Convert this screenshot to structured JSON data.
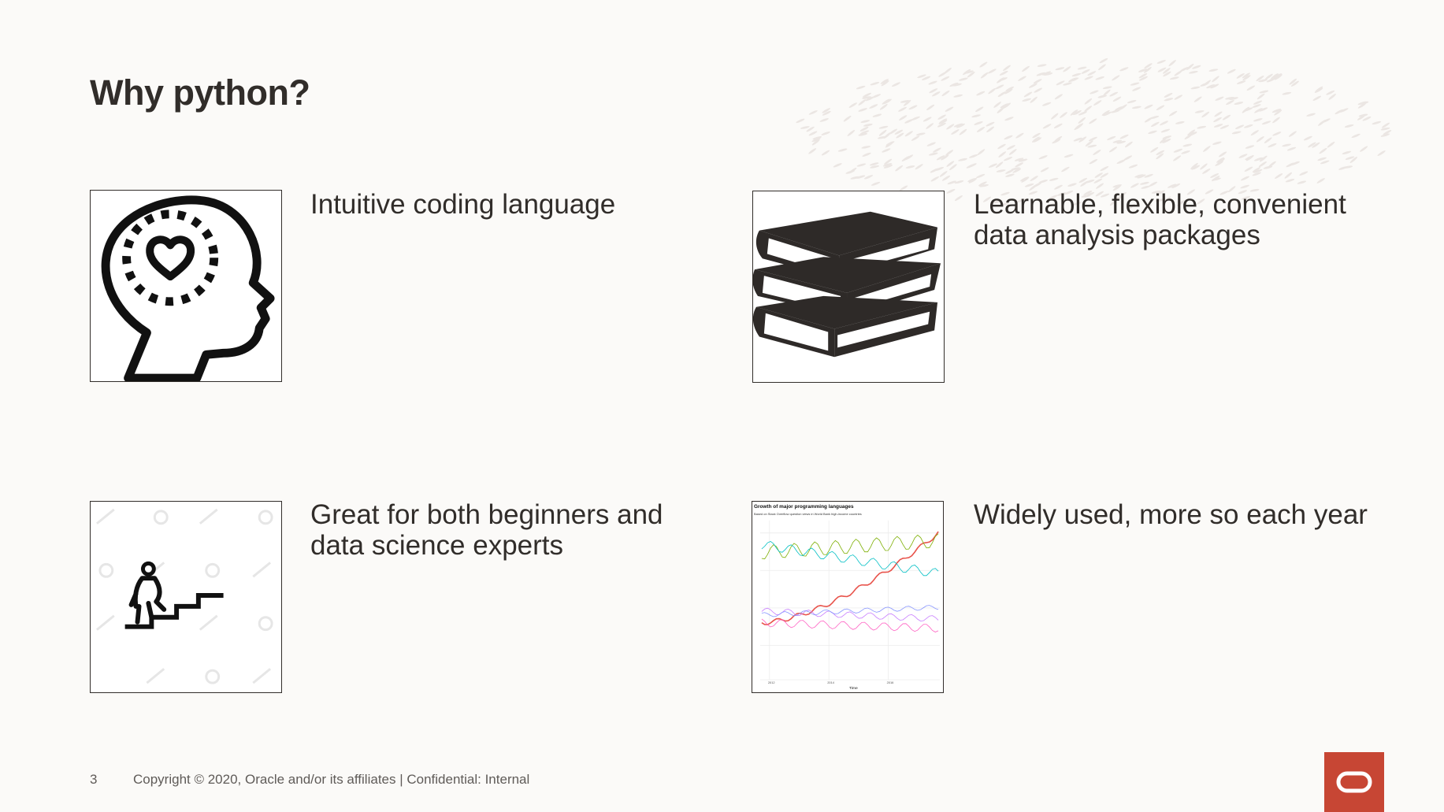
{
  "slide": {
    "title": "Why python?",
    "page_number": "3",
    "footer_text": "Copyright © 2020, Oracle and/or its affiliates  |  Confidential: Internal",
    "brand_color": "#c74634",
    "text_color": "#312d2a"
  },
  "items": [
    {
      "icon": "head-heart-icon",
      "caption": "Intuitive coding language"
    },
    {
      "icon": "books-icon",
      "caption": "Learnable, flexible, convenient\ndata analysis packages"
    },
    {
      "icon": "stairs-climber-icon",
      "caption": "Great for both beginners and\ndata science experts"
    },
    {
      "icon": "language-growth-chart-thumbnail",
      "caption": "Widely used, more so each year"
    }
  ],
  "chart_thumbnail": {
    "title": "Growth of major programming languages",
    "subtitle": "Based on Stack Overflow question views in World Bank high-income countries",
    "xlabel": "Time",
    "x_ticks": [
      "2012",
      "2014",
      "2016"
    ],
    "series_colors": [
      "#e8524a",
      "#7cae00",
      "#00bfc4",
      "#c77cff",
      "#f8766d",
      "#8794ff",
      "#ff61c3"
    ]
  }
}
